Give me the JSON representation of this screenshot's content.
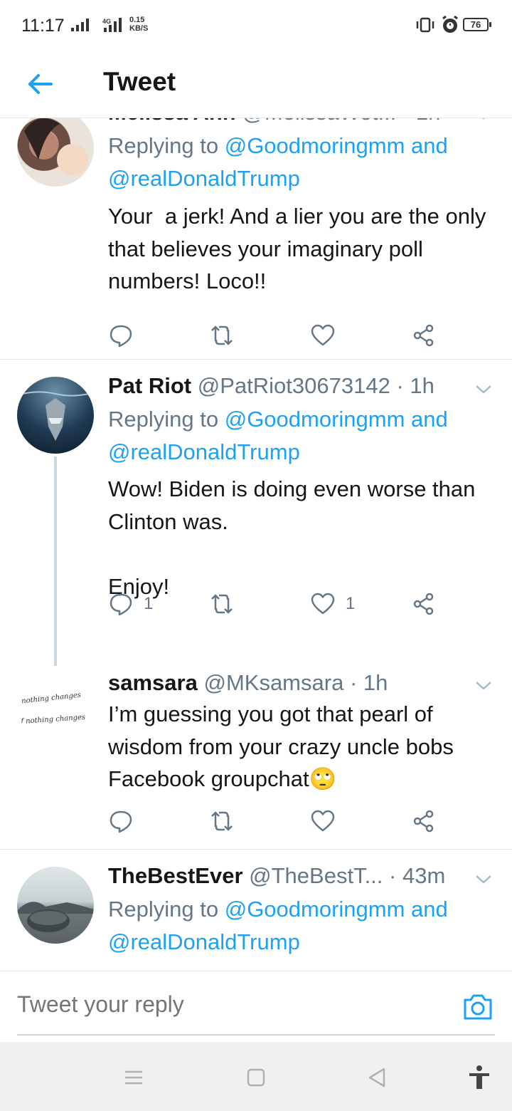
{
  "status_bar": {
    "time": "11:17",
    "network": "4G",
    "speed_value": "0.15",
    "speed_unit": "KB/S",
    "battery": "76"
  },
  "header": {
    "title": "Tweet",
    "back_icon": "arrow-left-icon"
  },
  "colors": {
    "accent": "#1da1f2",
    "text": "#14171a",
    "muted": "#657786",
    "divider": "#e1e8ed"
  },
  "tweets": [
    {
      "name": "Melissa Ann",
      "handle": "@MelissaWet...",
      "time": "· 1h",
      "replying_prefix": "Replying to",
      "replying_line1": "@Goodmoringmm and",
      "replying_line2": "@realDonaldTrump",
      "text": "Your  a jerk! And a lier you are the only that believes your imaginary poll numbers! Loco!!",
      "reply_count": "",
      "like_count": ""
    },
    {
      "name": "Pat Riot",
      "handle": "@PatRiot30673142",
      "time": "· 1h",
      "replying_prefix": "Replying to",
      "replying_line1": "@Goodmoringmm and",
      "replying_line2": "@realDonaldTrump",
      "text": "Wow! Biden is doing even worse than Clinton was.\n\nEnjoy!",
      "reply_count": "1",
      "like_count": "1"
    },
    {
      "name": "samsara",
      "handle": "@MKsamsara",
      "time": "· 1h",
      "avatar_text_line1": "nothing changes",
      "avatar_text_line2": "if nothing changes",
      "text": "I’m guessing you got that pearl of wisdom from your crazy uncle bobs Facebook groupchat🙄",
      "reply_count": "",
      "like_count": ""
    },
    {
      "name": "TheBestEver",
      "handle": "@TheBestT...",
      "time": "· 43m",
      "replying_prefix": "Replying to",
      "replying_line1": "@Goodmoringmm and",
      "replying_line2": "@realDonaldTrump"
    }
  ],
  "reply_bar": {
    "placeholder": "Tweet your reply",
    "camera_icon": "camera-icon"
  },
  "nav_bar": {
    "icons": [
      "menu-icon",
      "home-square-icon",
      "back-triangle-icon",
      "accessibility-icon"
    ]
  }
}
